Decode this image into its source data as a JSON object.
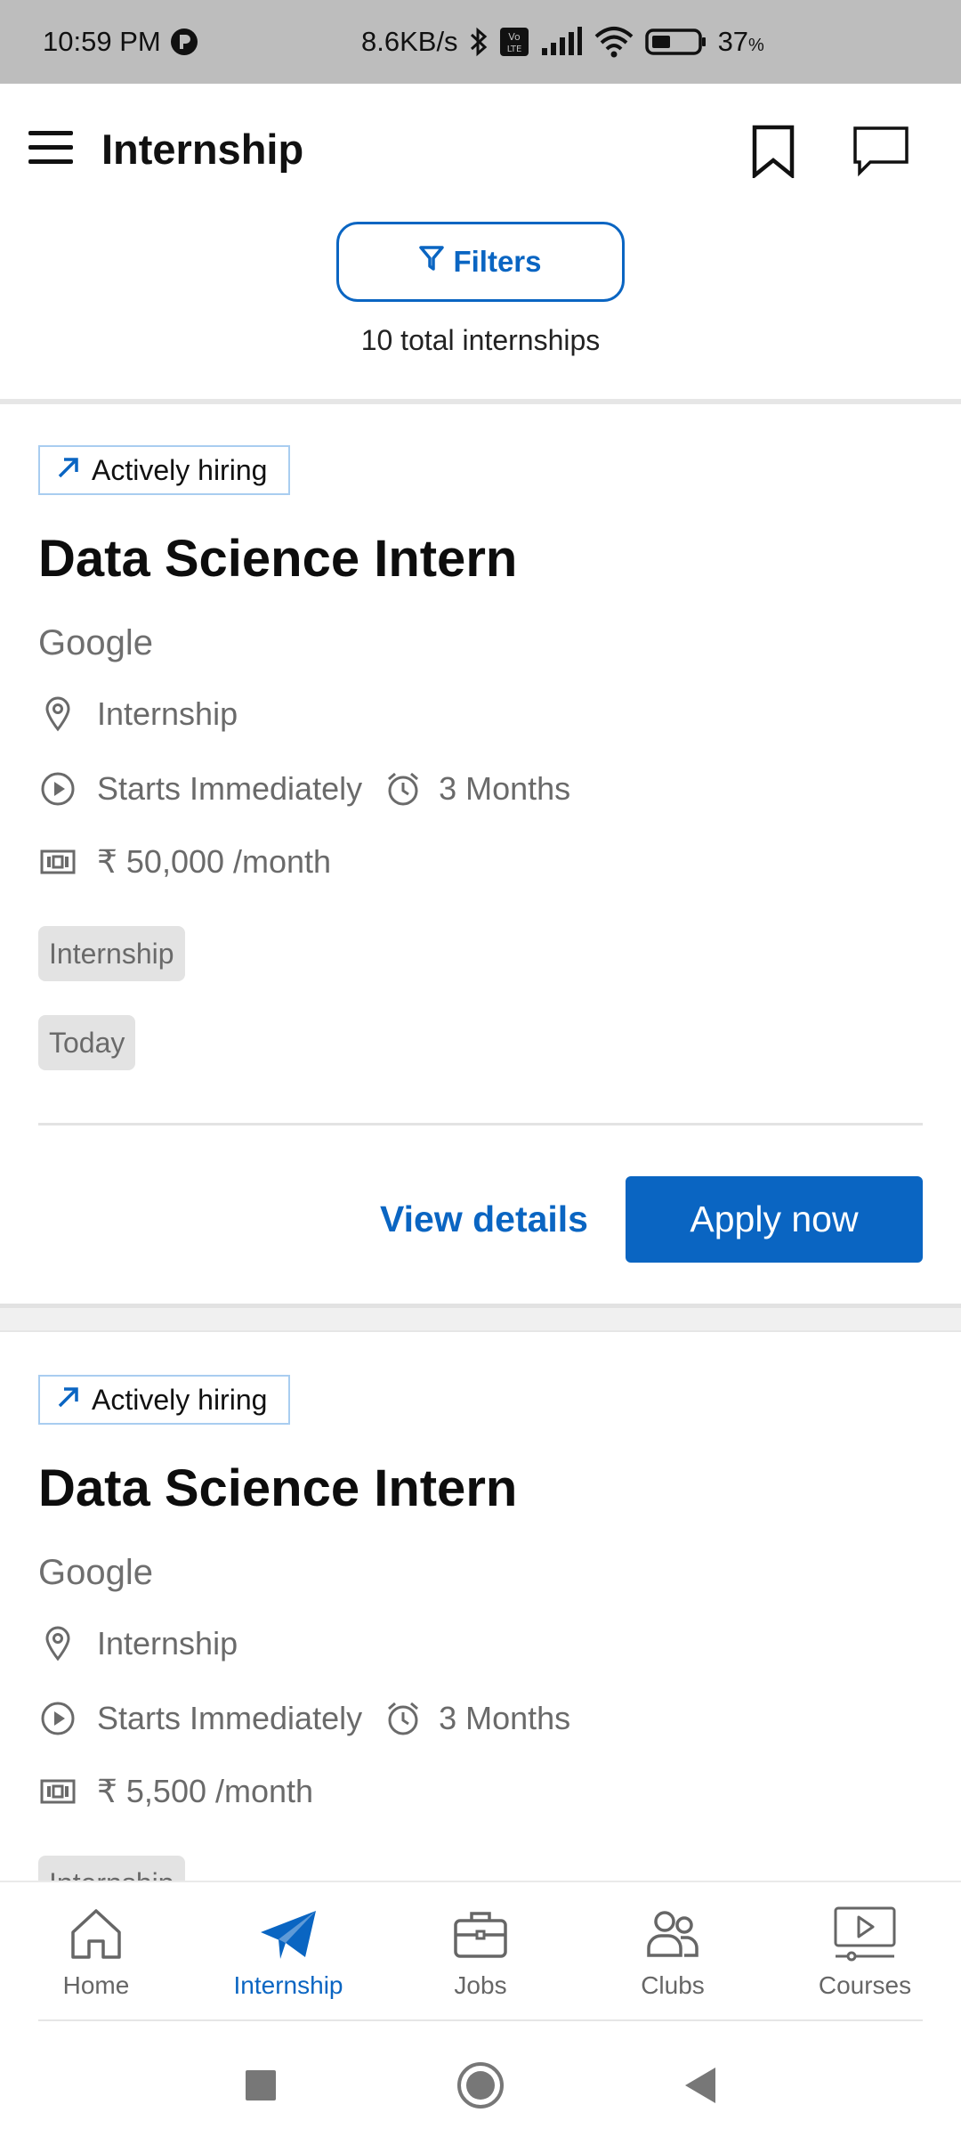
{
  "status_bar": {
    "time": "10:59 PM",
    "net_speed": "8.6KB/s",
    "battery": "37",
    "battery_unit": "%"
  },
  "app_bar": {
    "title": "Internship"
  },
  "filters": {
    "label": "Filters",
    "total_text": "10 total internships"
  },
  "cards": [
    {
      "badge": "Actively hiring",
      "title": "Data Science Intern",
      "company": "Google",
      "location": "Internship",
      "start": "Starts Immediately",
      "duration": "3 Months",
      "stipend": "₹ 50,000 /month",
      "tags": [
        "Internship",
        "Today"
      ],
      "view_details": "View details",
      "apply": "Apply now"
    },
    {
      "badge": "Actively hiring",
      "title": "Data Science Intern",
      "company": "Google",
      "location": "Internship",
      "start": "Starts Immediately",
      "duration": "3 Months",
      "stipend": "₹ 5,500 /month",
      "tags": [
        "Internship"
      ]
    }
  ],
  "bottom_nav": [
    {
      "label": "Home",
      "icon": "home-icon"
    },
    {
      "label": "Internship",
      "icon": "paper-plane-icon",
      "active": true
    },
    {
      "label": "Jobs",
      "icon": "briefcase-icon"
    },
    {
      "label": "Clubs",
      "icon": "people-icon"
    },
    {
      "label": "Courses",
      "icon": "play-screen-icon"
    }
  ],
  "colors": {
    "accent": "#0a65c2",
    "status_bar": "#bdbdbd",
    "tag_bg": "#e3e3e3",
    "badge_border": "#a9cdf0"
  }
}
